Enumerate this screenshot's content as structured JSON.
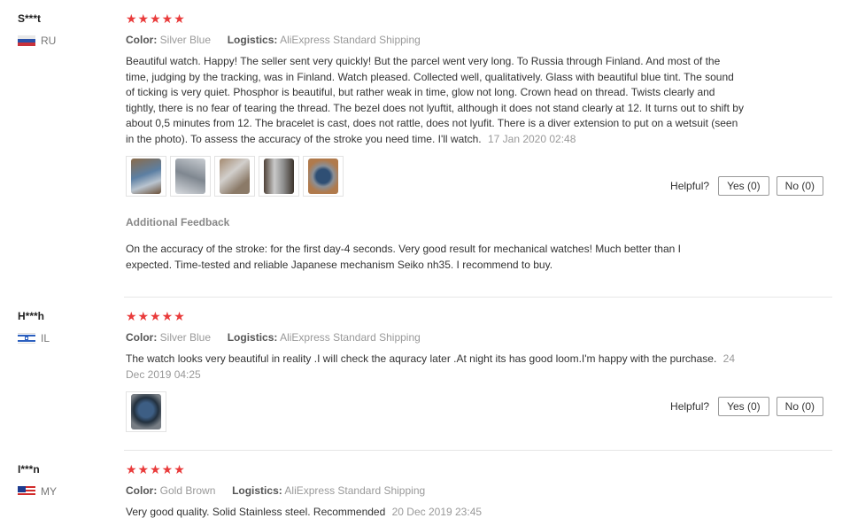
{
  "reviews": [
    {
      "username": "S***t",
      "country": "RU",
      "stars": "★★★★★",
      "color_label": "Color:",
      "color_value": "Silver Blue",
      "logistics_label": "Logistics:",
      "logistics_value": "AliExpress Standard Shipping",
      "text": "Beautiful watch. Happy! The seller sent very quickly! But the parcel went very long. To Russia through Finland. And most of the time, judging by the tracking, was in Finland. Watch pleased. Collected well, qualitatively. Glass with beautiful blue tint. The sound of ticking is very quiet. Phosphor is beautiful, but rather weak in time, glow not long. Crown head on thread. Twists clearly and tightly, there is no fear of tearing the thread. The bezel does not lyuftit, although it does not stand clearly at 12. It turns out to shift by about 0,5 minutes from 12. The bracelet is cast, does not rattle, does not lyufit. There is a diver extension to put on a wetsuit (seen in the photo). To assess the accuracy of the stroke you need time. I'll watch.",
      "date": "17 Jan 2020 02:48",
      "helpful_label": "Helpful?",
      "yes_label": "Yes (0)",
      "no_label": "No (0)",
      "additional_title": "Additional Feedback",
      "additional_text": "On the accuracy of the stroke: for the first day-4 seconds. Very good result for mechanical watches! Much better than I expected. Time-tested and reliable Japanese mechanism Seiko nh35. I recommend to buy."
    },
    {
      "username": "H***h",
      "country": "IL",
      "stars": "★★★★★",
      "color_label": "Color:",
      "color_value": "Silver Blue",
      "logistics_label": "Logistics:",
      "logistics_value": "AliExpress Standard Shipping",
      "text": "The watch looks very beautiful in reality .I will check the aquracy later .At night its has good loom.I'm happy with the purchase.",
      "date": "24 Dec 2019 04:25",
      "helpful_label": "Helpful?",
      "yes_label": "Yes (0)",
      "no_label": "No (0)"
    },
    {
      "username": "I***n",
      "country": "MY",
      "stars": "★★★★★",
      "color_label": "Color:",
      "color_value": "Gold Brown",
      "logistics_label": "Logistics:",
      "logistics_value": "AliExpress Standard Shipping",
      "text": "Very good quality. Solid Stainless steel. Recommended",
      "date": "20 Dec 2019 23:45"
    }
  ],
  "colors": {
    "star": "#e93b3b",
    "divider": "#e6e6e6"
  }
}
